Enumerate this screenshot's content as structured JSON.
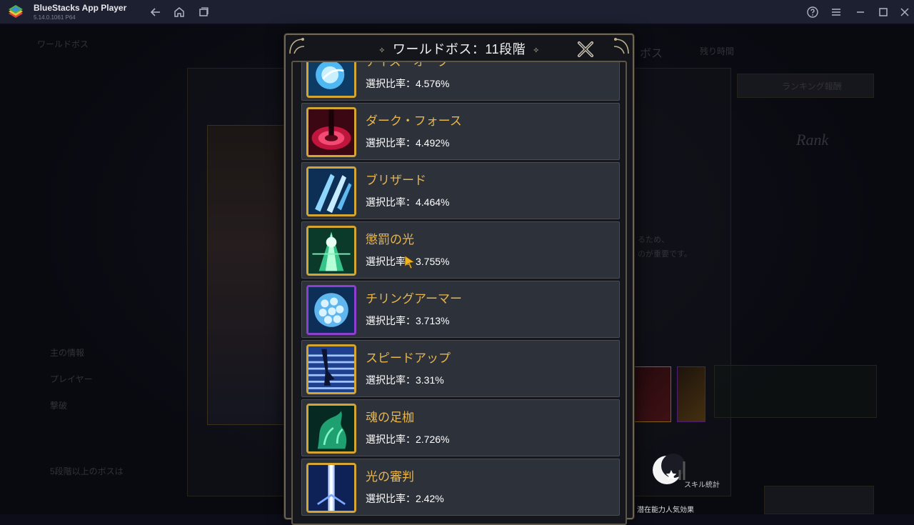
{
  "window": {
    "app_title": "BlueStacks App Player",
    "app_version": "5.14.0.1061 P64"
  },
  "background": {
    "left_header": "ワールドボス",
    "right_tab": "ボス",
    "right_header": "残り時間",
    "ranking_button": "ランキング報酬",
    "rank_label": "Rank",
    "desc_lines": [
      "るため、",
      "のが重要です。"
    ],
    "left_lines": [
      "主の情報",
      "プレイヤー",
      "撃破",
      "5段階以上のボスは"
    ],
    "skill_stats_label": "スキル統計",
    "potential_label": "潜在能力人気効果"
  },
  "modal": {
    "title": "ワールドボス：11段階",
    "close_icon": "close-x-icon"
  },
  "skills": [
    {
      "name": "アイス・オーブ",
      "rate": "選択比率：4.576%",
      "icon": "ice-orb-icon"
    },
    {
      "name": "ダーク・フォース",
      "rate": "選択比率：4.492%",
      "icon": "dark-force-icon"
    },
    {
      "name": "ブリザード",
      "rate": "選択比率：4.464%",
      "icon": "blizzard-icon"
    },
    {
      "name": "懲罰の光",
      "rate": "選択比率：3.755%",
      "icon": "punishment-light-icon"
    },
    {
      "name": "チリングアーマー",
      "rate": "選択比率：3.713%",
      "icon": "chilling-armor-icon"
    },
    {
      "name": "スピードアップ",
      "rate": "選択比率：3.31%",
      "icon": "speed-up-icon"
    },
    {
      "name": "魂の足枷",
      "rate": "選択比率：2.726%",
      "icon": "soul-shackle-icon"
    },
    {
      "name": "光の審判",
      "rate": "選択比率：2.42%",
      "icon": "light-judgment-icon"
    }
  ]
}
